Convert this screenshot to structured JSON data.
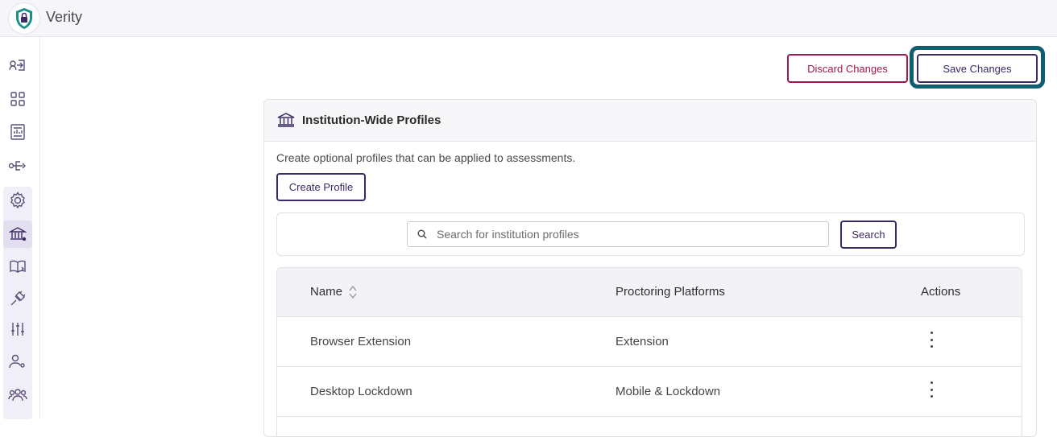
{
  "app": {
    "title": "Verity"
  },
  "colors": {
    "accent": "#3c2a66",
    "danger": "#a2174e",
    "focus_ring": "#0f5d70",
    "logo": "#1b8f8a"
  },
  "sidebar": {
    "items": [
      {
        "name": "login-icon"
      },
      {
        "name": "dashboard-grid-icon"
      },
      {
        "name": "reports-icon"
      },
      {
        "name": "integrations-icon"
      },
      {
        "name": "settings-gear-icon"
      },
      {
        "name": "institution-icon",
        "active": true
      },
      {
        "name": "book-icon"
      },
      {
        "name": "plugin-icon"
      },
      {
        "name": "sliders-icon"
      },
      {
        "name": "user-settings-icon"
      },
      {
        "name": "users-group-icon"
      }
    ]
  },
  "toolbar": {
    "discard_label": "Discard Changes",
    "save_label": "Save Changes"
  },
  "card": {
    "title": "Institution-Wide Profiles",
    "description": "Create optional profiles that can be applied to assessments.",
    "create_label": "Create Profile",
    "search": {
      "placeholder": "Search for institution profiles",
      "value": "",
      "button_label": "Search"
    },
    "table": {
      "columns": [
        "Name",
        "Proctoring Platforms",
        "Actions"
      ],
      "rows": [
        {
          "name": "Browser Extension",
          "platform": "Extension"
        },
        {
          "name": "Desktop Lockdown",
          "platform": "Mobile & Lockdown"
        }
      ]
    }
  }
}
